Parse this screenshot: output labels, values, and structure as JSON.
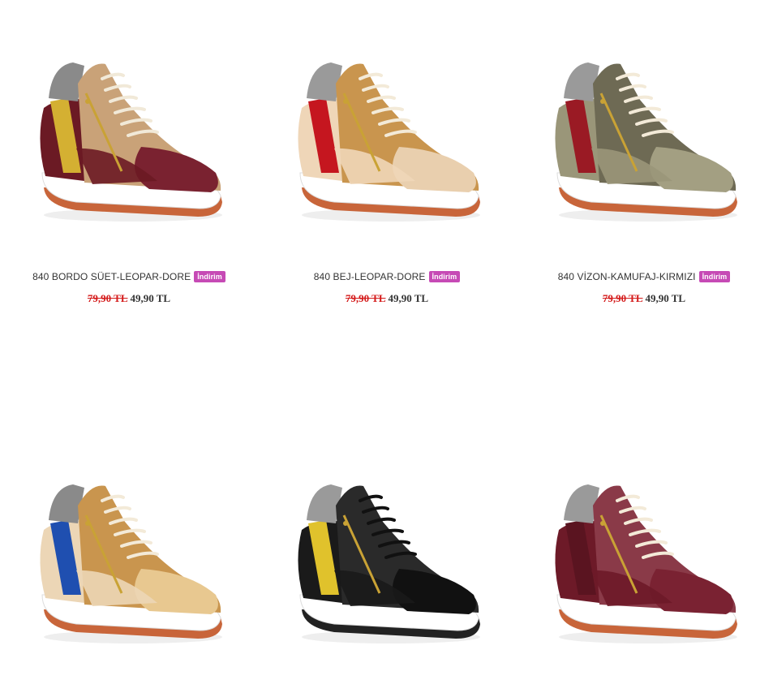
{
  "products": [
    {
      "name": "840 BORDO SÜET-LEOPAR-DORE",
      "badge": "İndirim",
      "old_price": "79,90 TL",
      "new_price": "49,90 TL",
      "colors": {
        "upper": "#6b1a24",
        "toe": "#7a2230",
        "panel": "#c9a278",
        "accent": "#d4b032",
        "collar": "#8a8a8a",
        "sole": "#ffffff",
        "outsole": "#c8653a",
        "lace": "#f1e9d8"
      }
    },
    {
      "name": "840 BEJ-LEOPAR-DORE",
      "badge": "İndirim",
      "old_price": "79,90 TL",
      "new_price": "49,90 TL",
      "colors": {
        "upper": "#efd6b8",
        "toe": "#e9cfae",
        "panel": "#c9954e",
        "accent": "#c5161f",
        "collar": "#9a9a9a",
        "sole": "#ffffff",
        "outsole": "#c8653a",
        "lace": "#f3ead8"
      }
    },
    {
      "name": "840 VİZON-KAMUFAJ-KIRMIZI",
      "badge": "İndirim",
      "old_price": "79,90 TL",
      "new_price": "49,90 TL",
      "colors": {
        "upper": "#9a9679",
        "toe": "#a39f82",
        "panel": "#6e6a54",
        "accent": "#9a1a24",
        "collar": "#9a9a9a",
        "sole": "#ffffff",
        "outsole": "#c8653a",
        "lace": "#f3ead8"
      }
    },
    {
      "name": "",
      "badge": "",
      "old_price": "",
      "new_price": "",
      "colors": {
        "upper": "#ecd6b6",
        "toe": "#e8c890",
        "panel": "#c9954e",
        "accent": "#1f4fb0",
        "collar": "#8a8a8a",
        "sole": "#ffffff",
        "outsole": "#c8653a",
        "lace": "#f3ead8"
      }
    },
    {
      "name": "",
      "badge": "",
      "old_price": "",
      "new_price": "",
      "colors": {
        "upper": "#1a1a1a",
        "toe": "#111111",
        "panel": "#2a2a2a",
        "accent": "#e0c22c",
        "collar": "#9a9a9a",
        "sole": "#ffffff",
        "outsole": "#222222",
        "lace": "#111111"
      }
    },
    {
      "name": "",
      "badge": "",
      "old_price": "",
      "new_price": "",
      "colors": {
        "upper": "#6d1a28",
        "toe": "#7a2232",
        "panel": "#8a3a48",
        "accent": "#5a1420",
        "collar": "#9a9a9a",
        "sole": "#ffffff",
        "outsole": "#c8653a",
        "lace": "#f3ead8"
      }
    }
  ]
}
